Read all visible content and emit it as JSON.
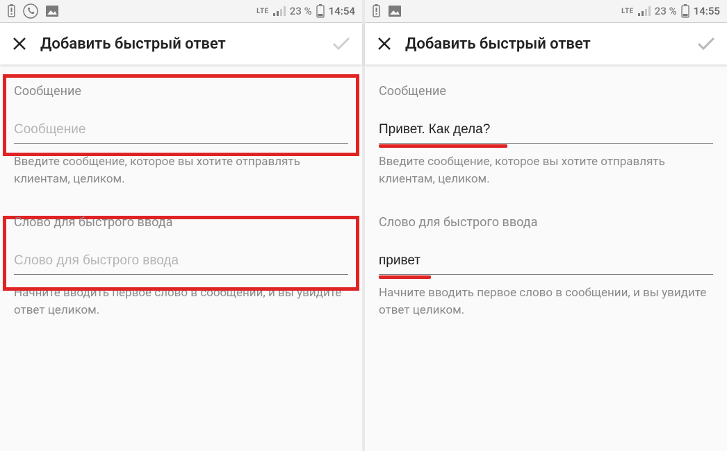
{
  "status": {
    "network": "LTE",
    "battery_pct": "23 %",
    "time_left": "14:54",
    "time_right": "14:55"
  },
  "header": {
    "title": "Добавить быстрый ответ"
  },
  "fields": {
    "message": {
      "label": "Сообщение",
      "placeholder": "Сообщение",
      "value_right": "Привет. Как дела?",
      "helper": "Введите сообщение, которое вы хотите отправлять клиентам, целиком."
    },
    "shortcut": {
      "label": "Слово для быстрого ввода",
      "placeholder": "Слово для быстрого ввода",
      "value_right": "привет",
      "helper": "Начните вводить первое слово в сообщении, и вы увидите ответ целиком."
    }
  }
}
